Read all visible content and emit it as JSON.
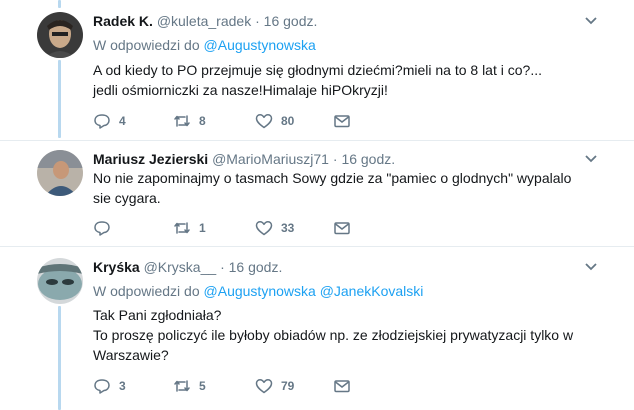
{
  "tweets": [
    {
      "name": "Radek K.",
      "handle": "@kuleta_radek",
      "dot": "·",
      "time": "16 godz.",
      "reply_prefix": "W odpowiedzi do",
      "reply_mentions": [
        "@Augustynowska"
      ],
      "lines": [
        "A od kiedy to PO przejmuje się głodnymi dziećmi?mieli na to 8 lat i co?...",
        "jedli ośmiorniczki za nasze!Himalaje hiPOkryzji!"
      ],
      "replies": "4",
      "retweets": "8",
      "likes": "80"
    },
    {
      "name": "Mariusz Jezierski",
      "handle": "@MarioMariuszj71",
      "dot": "·",
      "time": "16 godz.",
      "lines": [
        "No nie zapominajmy o tasmach Sowy gdzie za \"pamiec o glodnych\" wypalalo",
        "sie cygara."
      ],
      "replies": "",
      "retweets": "1",
      "likes": "33"
    },
    {
      "name": "Kryśka",
      "handle": "@Kryska__",
      "dot": "·",
      "time": "16 godz.",
      "reply_prefix": "W odpowiedzi do",
      "reply_mentions": [
        "@Augustynowska",
        "@JanekKovalski"
      ],
      "lines": [
        "Tak Pani zgłodniała?",
        "To proszę policzyć ile byłoby obiadów np. ze złodziejskiej prywatyzacji tylko w",
        "Warszawie?"
      ],
      "replies": "3",
      "retweets": "5",
      "likes": "79"
    }
  ],
  "colors": {
    "link": "#1da1f2",
    "muted": "#657786",
    "thread_line": "#b8d8ef",
    "separator": "#e6ecf0"
  },
  "icons": {
    "reply": "reply-icon",
    "retweet": "retweet-icon",
    "like": "heart-icon",
    "dm": "envelope-icon",
    "menu": "chevron-down-icon"
  }
}
